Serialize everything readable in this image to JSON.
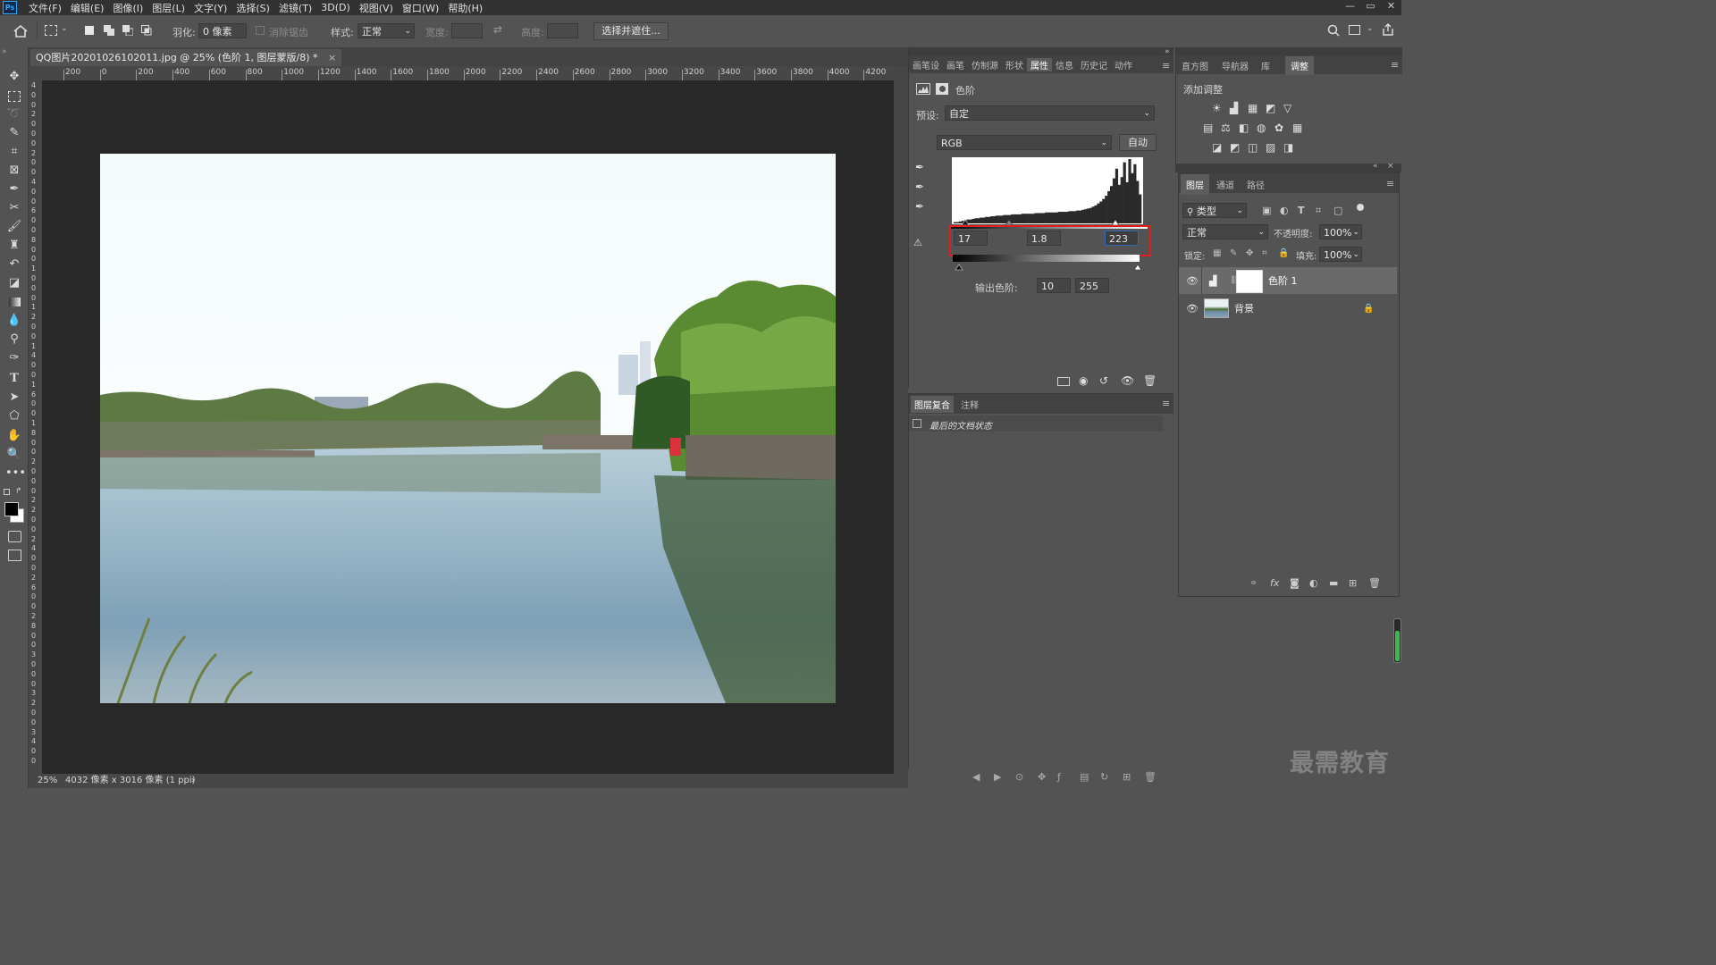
{
  "menubar": {
    "logo": "Ps",
    "items": [
      "文件(F)",
      "编辑(E)",
      "图像(I)",
      "图层(L)",
      "文字(Y)",
      "选择(S)",
      "滤镜(T)",
      "3D(D)",
      "视图(V)",
      "窗口(W)",
      "帮助(H)"
    ],
    "controls": [
      "—",
      "▭",
      "✕"
    ]
  },
  "options": {
    "feather_label": "羽化:",
    "feather_value": "0 像素",
    "antialias": "消除锯齿",
    "style_label": "样式:",
    "style_value": "正常",
    "width_label": "宽度:",
    "height_label": "高度:",
    "select_mask": "选择并遮住..."
  },
  "document": {
    "tab_title": "QQ图片20201026102011.jpg @ 25% (色阶 1, 图层蒙版/8) *",
    "ruler_top": [
      "200",
      "0",
      "200",
      "400",
      "600",
      "800",
      "1000",
      "1200",
      "1400",
      "1600",
      "1800",
      "2000",
      "2200",
      "2400",
      "2600",
      "2800",
      "3000",
      "3200",
      "3400",
      "3600",
      "3800",
      "4000",
      "4200"
    ],
    "ruler_left": [
      "4",
      "0",
      "0",
      "2",
      "0",
      "0",
      "0",
      "2",
      "0",
      "0",
      "4",
      "0",
      "0",
      "6",
      "0",
      "0",
      "8",
      "0",
      "0",
      "1",
      "0",
      "0",
      "0",
      "1",
      "2",
      "0",
      "0",
      "1",
      "4",
      "0",
      "0",
      "1",
      "6",
      "0",
      "0",
      "1",
      "8",
      "0",
      "0",
      "2",
      "0",
      "0",
      "0",
      "2",
      "2",
      "0",
      "0",
      "2",
      "4",
      "0",
      "0",
      "2",
      "6",
      "0",
      "0",
      "2",
      "8",
      "0",
      "0",
      "3",
      "0",
      "0",
      "0",
      "3",
      "2",
      "0",
      "0",
      "3",
      "4",
      "0",
      "0"
    ],
    "zoom": "25%",
    "info": "4032 像素 x 3016 像素 (1 ppi)",
    "info_arrow": "›"
  },
  "props_panel": {
    "tabs": [
      "画笔设",
      "画笔",
      "仿制源",
      "形状",
      "属性",
      "信息",
      "历史记",
      "动作"
    ],
    "active_tab": "属性",
    "title": "色阶",
    "preset_label": "预设:",
    "preset_value": "自定",
    "channel": "RGB",
    "auto": "自动",
    "input_black": "17",
    "input_gamma": "1.8",
    "input_white": "223",
    "output_label": "输出色阶:",
    "output_black": "10",
    "output_white": "255",
    "histogram": [
      2,
      2,
      3,
      4,
      5,
      6,
      6,
      7,
      8,
      8,
      9,
      9,
      10,
      10,
      11,
      11,
      12,
      12,
      12,
      13,
      13,
      13,
      14,
      14,
      14,
      14,
      15,
      15,
      15,
      15,
      15,
      16,
      16,
      16,
      16,
      17,
      17,
      17,
      17,
      17,
      18,
      18,
      18,
      18,
      19,
      19,
      19,
      20,
      20,
      21,
      22,
      23,
      24,
      26,
      28,
      31,
      34,
      38,
      43,
      50,
      58,
      70,
      85,
      60,
      72,
      95,
      64,
      100,
      78,
      92,
      66,
      45
    ],
    "highlight_color": "#e01e1e"
  },
  "comps_panel": {
    "tabs": [
      "图层复合",
      "注释"
    ],
    "item": "最后的文档状态"
  },
  "right_top": {
    "tabs": [
      "直方图",
      "导航器",
      "库",
      "调整"
    ],
    "active_tab": "调整",
    "add_adjust": "添加调整"
  },
  "layers_panel": {
    "tabs": [
      "图层",
      "通道",
      "路径"
    ],
    "filter": "类型",
    "blend_mode": "正常",
    "opacity_label": "不透明度:",
    "opacity_value": "100%",
    "lock_label": "锁定:",
    "fill_label": "填充:",
    "fill_value": "100%",
    "layers": [
      {
        "name": "色阶 1"
      },
      {
        "name": "背景"
      }
    ]
  },
  "watermark": "最需教育"
}
